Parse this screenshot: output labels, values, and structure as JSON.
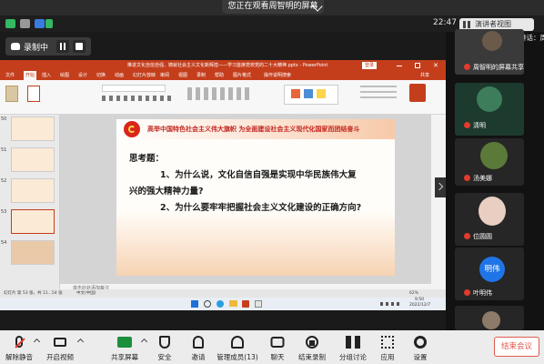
{
  "share_banner": {
    "text": "您正在观看周智明的屏幕"
  },
  "status_bar": {
    "time": "22:47"
  },
  "recording": {
    "label": "录制中"
  },
  "ppt": {
    "title": "推进文化自信自强、铸就社会主义文化新辉煌——学习首席党校党的二十大精神.pptx - PowerPoint",
    "login_btn": "登录",
    "menu": [
      "文件",
      "开始",
      "插入",
      "绘图",
      "设计",
      "切换",
      "动画",
      "幻灯片放映",
      "审阅",
      "视图",
      "录制",
      "帮助",
      "图片格式",
      "操作说明搜索"
    ],
    "share_btn": "共享",
    "thumb_numbers": [
      "50",
      "51",
      "52",
      "53",
      "54"
    ],
    "notes_hint": "单击此处添加备注",
    "status_left": "幻灯片 第 53 张，共 11...54 张",
    "status_lang": "中文(中国)",
    "status_zoom": "62%",
    "taskbar_time": "9:50",
    "taskbar_date": "2022/12/7"
  },
  "slide": {
    "title": "高举中国特色社会主义伟大旗帜 为全面建设社会主义现代化国家而团结奋斗",
    "line1": "思考题：",
    "line2": "1、为什么说，文化自信自强是实现中华民族伟大复",
    "line3": "兴的强大精神力量?",
    "line4": "2、为什么要牢牢把握社会主义文化建设的正确方向?"
  },
  "right_panel": {
    "speaker_view": "演讲者视图",
    "now_speaking": "正在讲话：周",
    "participants": [
      {
        "name": "周智明的屏幕共享"
      },
      {
        "name": "清明"
      },
      {
        "name": "汤美娜"
      },
      {
        "name": "位圆圆"
      },
      {
        "name": "叶明伟",
        "avatar_text": "明伟"
      }
    ]
  },
  "toolbar": {
    "items": [
      {
        "label": "解除静音",
        "icon": "mic-muted-icon"
      },
      {
        "label": "开启视频",
        "icon": "video-off-icon"
      },
      {
        "label": "共享屏幕",
        "icon": "share-screen-icon"
      },
      {
        "label": "安全",
        "icon": "shield-icon"
      },
      {
        "label": "邀请",
        "icon": "invite-icon"
      },
      {
        "label": "管理成员(13)",
        "icon": "members-icon"
      },
      {
        "label": "聊天",
        "icon": "chat-icon"
      },
      {
        "label": "结束录制",
        "icon": "record-stop-icon"
      },
      {
        "label": "分组讨论",
        "icon": "breakout-icon"
      },
      {
        "label": "应用",
        "icon": "apps-icon"
      },
      {
        "label": "设置",
        "icon": "gear-icon"
      }
    ],
    "end_meeting": "结束会议"
  },
  "colors": {
    "ppt_red": "#c43e1c",
    "accent_red": "#e05a4e",
    "slide_title_red": "#c2251f"
  }
}
